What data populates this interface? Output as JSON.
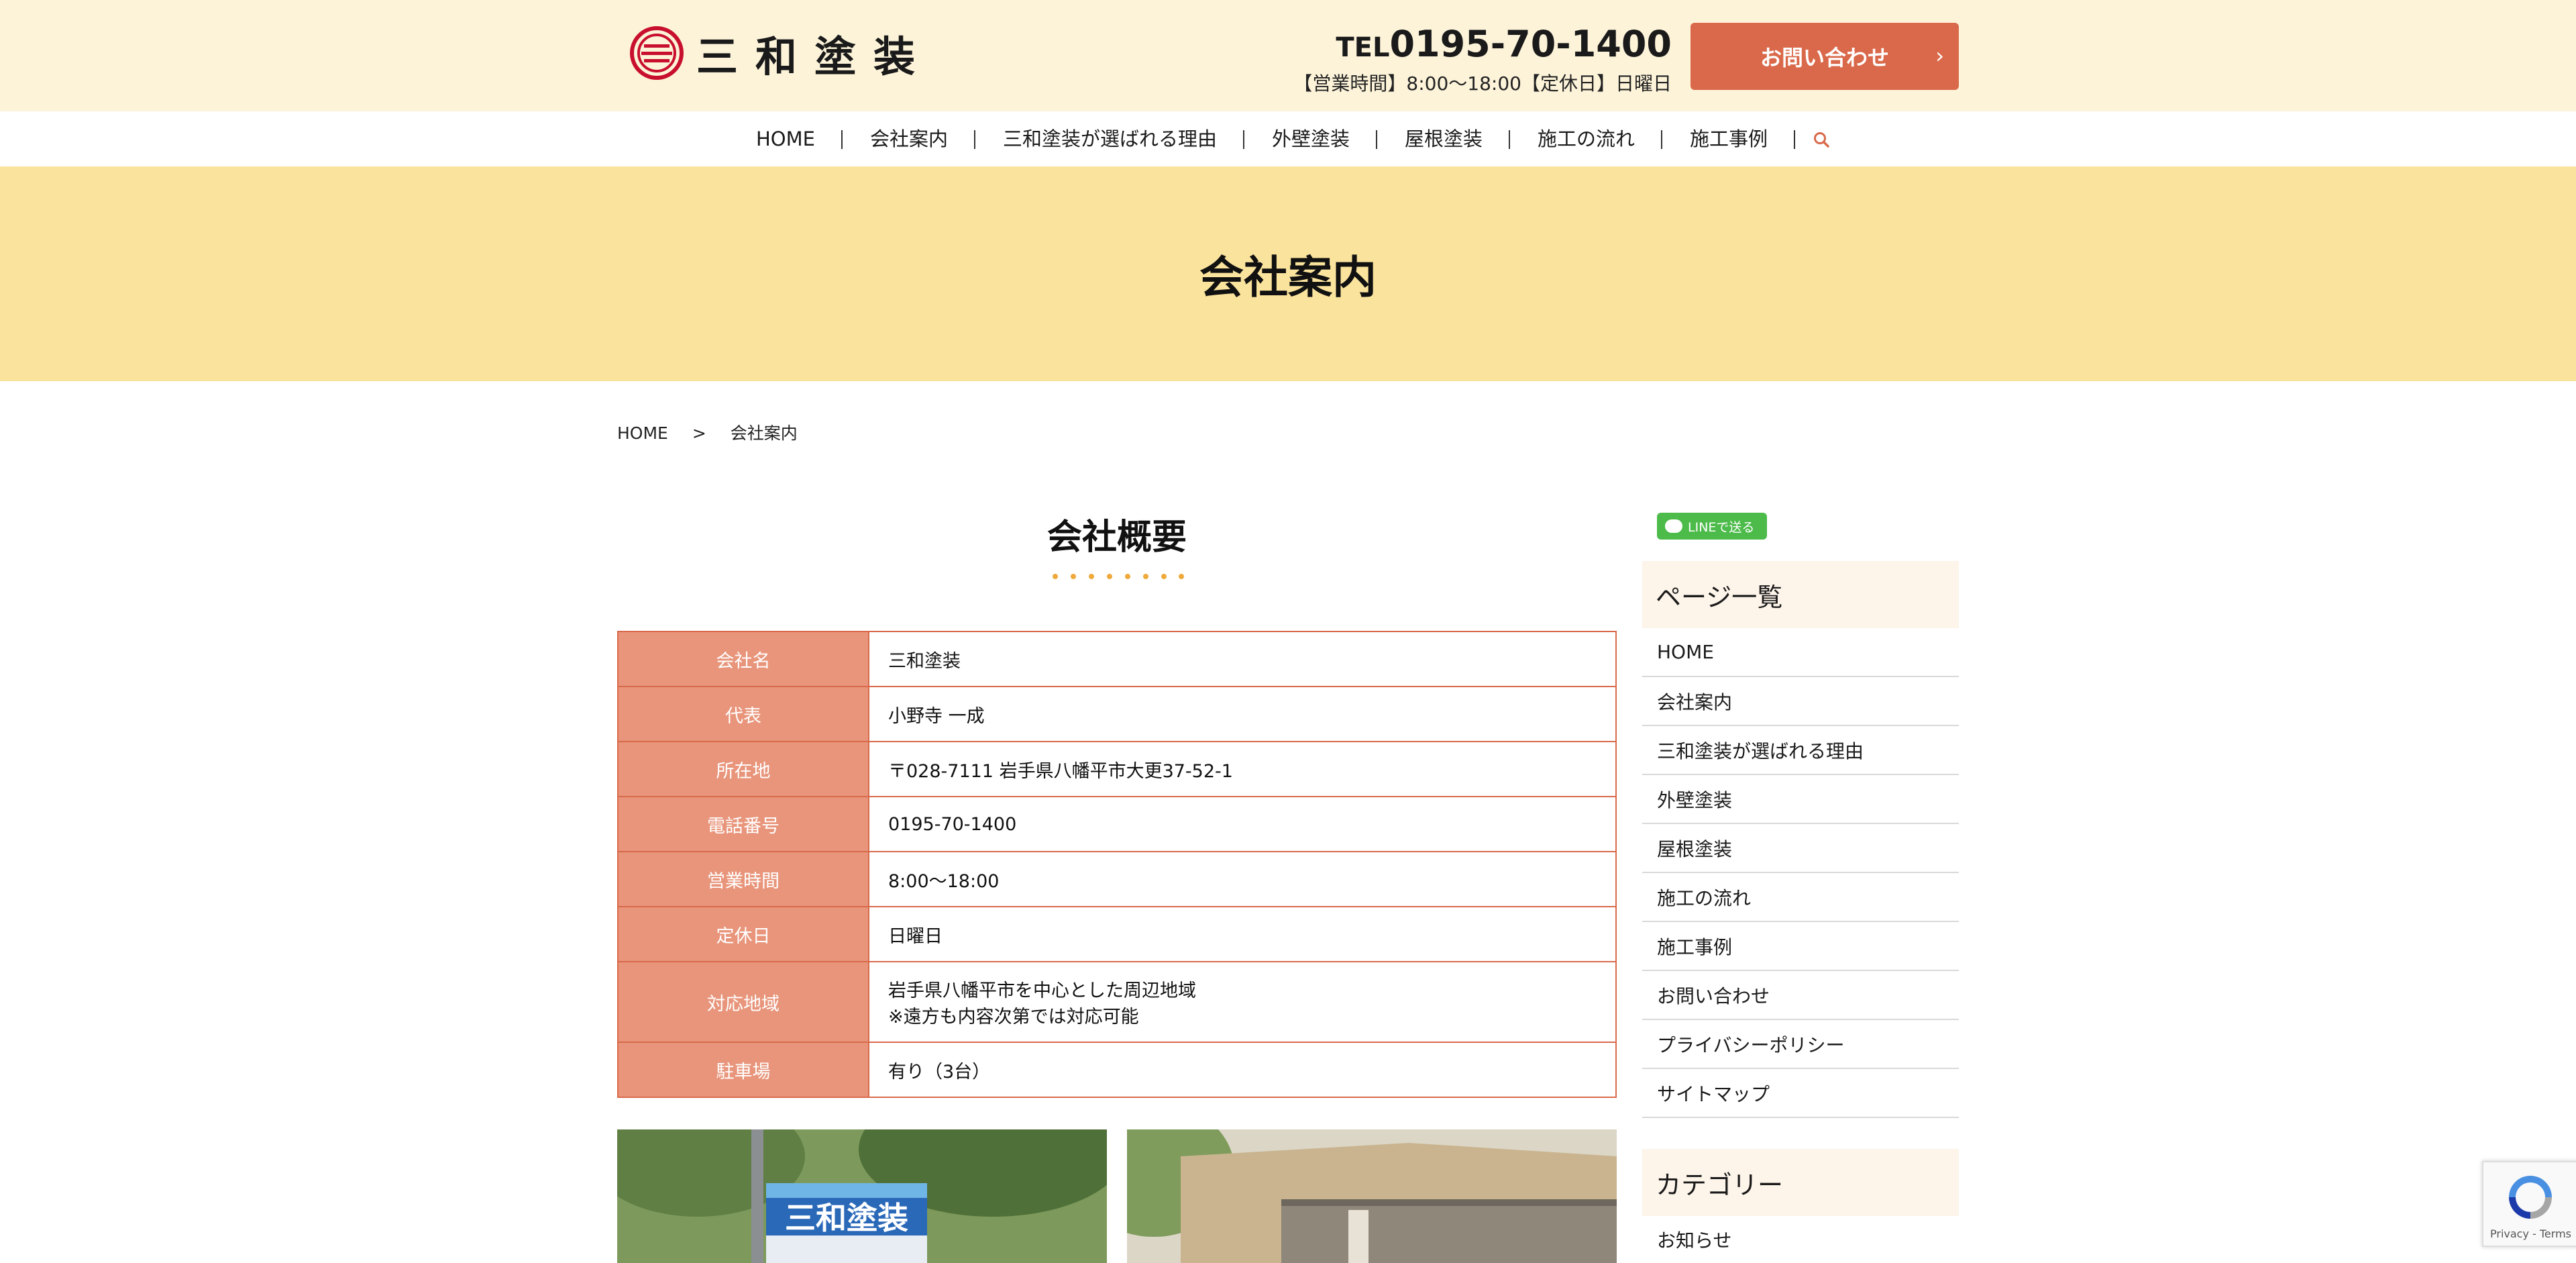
{
  "header": {
    "logo_text": "三和塗装",
    "tel_prefix": "TEL",
    "tel": "0195-70-1400",
    "hours": "【営業時間】8:00〜18:00【定休日】日曜日",
    "contact_label": "お問い合わせ",
    "accent_color": "#d9694a"
  },
  "nav": {
    "items": [
      "HOME",
      "会社案内",
      "三和塗装が選ばれる理由",
      "外壁塗装",
      "屋根塗装",
      "施工の流れ",
      "施工事例"
    ],
    "search_icon": "search-icon"
  },
  "banner": {
    "title": "会社案内"
  },
  "breadcrumb": {
    "home": "HOME",
    "sep": ">",
    "current": "会社案内"
  },
  "section": {
    "title": "会社概要"
  },
  "company_table": {
    "rows": [
      {
        "label": "会社名",
        "value": "三和塗装"
      },
      {
        "label": "代表",
        "value": "小野寺 一成"
      },
      {
        "label": "所在地",
        "value": "〒028-7111 岩手県八幡平市大更37-52-1"
      },
      {
        "label": "電話番号",
        "value": "0195-70-1400"
      },
      {
        "label": "営業時間",
        "value": "8:00〜18:00"
      },
      {
        "label": "定休日",
        "value": "日曜日"
      },
      {
        "label": "対応地域",
        "value": "岩手県八幡平市を中心とした周辺地域",
        "value2": "※遠方も内容次第では対応可能"
      },
      {
        "label": "駐車場",
        "value": "有り（3台）"
      }
    ]
  },
  "photos": {
    "sign_text": "三和塗装"
  },
  "sidebar": {
    "line_button": "LINEで送る",
    "pages_heading": "ページ一覧",
    "pages": [
      "HOME",
      "会社案内",
      "三和塗装が選ばれる理由",
      "外壁塗装",
      "屋根塗装",
      "施工の流れ",
      "施工事例",
      "お問い合わせ",
      "プライバシーポリシー",
      "サイトマップ"
    ],
    "category_heading": "カテゴリー",
    "categories": [
      "お知らせ"
    ]
  },
  "recaptcha": {
    "terms": "Privacy - Terms"
  }
}
